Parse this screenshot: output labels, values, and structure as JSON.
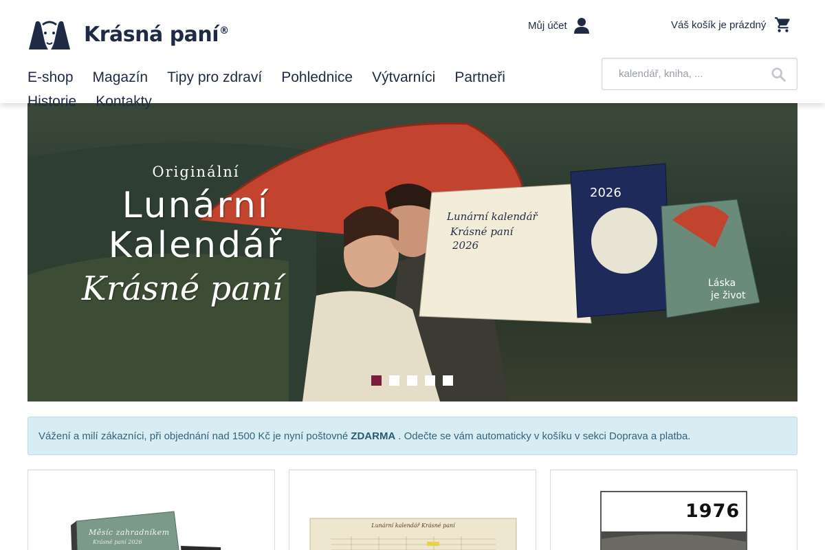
{
  "brand": {
    "name": "Krásná paní",
    "mark": "®"
  },
  "header": {
    "account_label": "Můj účet",
    "cart_label": "Váš košík je prázdný"
  },
  "nav": [
    {
      "label": "E-shop"
    },
    {
      "label": "Magazín"
    },
    {
      "label": "Tipy pro zdraví"
    },
    {
      "label": "Pohlednice"
    },
    {
      "label": "Výtvarníci"
    },
    {
      "label": "Partneři"
    },
    {
      "label": "Historie"
    },
    {
      "label": "Kontakty"
    }
  ],
  "search": {
    "placeholder": "kalendář, kniha, ..."
  },
  "hero": {
    "kicker": "Originální",
    "title_line1": "Lunární",
    "title_line2": "Kalendář",
    "script": "Krásné paní",
    "slides": {
      "count": 5,
      "active": 0
    },
    "products": {
      "desk_calendar": {
        "line1": "Lunární kalendář",
        "line2": "Krásné paní",
        "line3": "2026"
      },
      "wall_calendar": {
        "year": "2026"
      },
      "book": {
        "line1": "Láska",
        "line2": "je život"
      }
    }
  },
  "notice": {
    "text_before": "Vážení a milí zákazníci, při objednání nad 1500 Kč je nyní poštovné",
    "highlight": "ZDARMA",
    "text_after": ". Odečte se vám automaticky v košíku v sekci Doprava a platba."
  },
  "cards": [
    {
      "cover_title": "Měsíc zahradníkem",
      "cover_sub": "Krásné paní 2026"
    },
    {
      "doc_title": "Lunární kalendář Krásné paní"
    },
    {
      "year": "1976"
    }
  ],
  "colors": {
    "brand_navy": "#1f2a44",
    "accent_burgundy": "#7c1d3c",
    "notice_bg": "#d8ecf4",
    "notice_text": "#33637a"
  },
  "icons": [
    "logo-mark",
    "user-icon",
    "cart-icon",
    "search-icon"
  ]
}
